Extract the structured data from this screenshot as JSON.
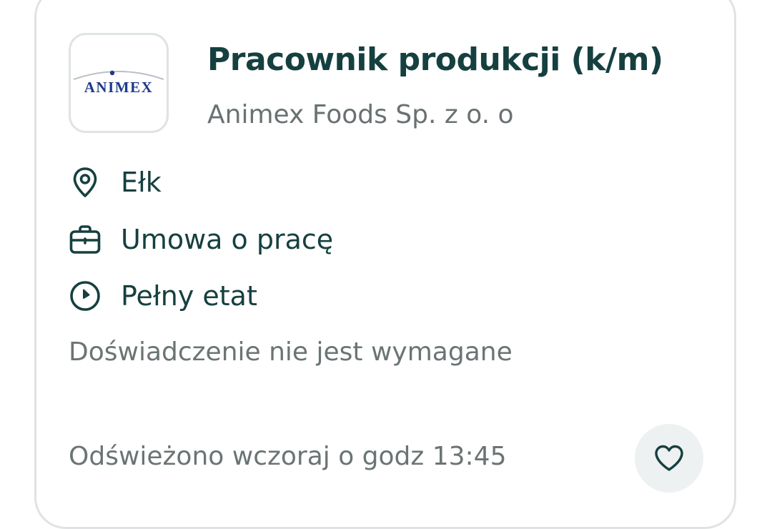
{
  "job": {
    "title": "Pracownik produkcji (k/m)",
    "company": "Animex Foods Sp. z o. o",
    "logo_text": "ANIMEX",
    "location": "Ełk",
    "contract": "Umowa o pracę",
    "time": "Pełny etat",
    "experience": "Doświadczenie nie jest wymagane",
    "refreshed": "Odświeżono wczoraj o godz 13:45"
  },
  "icons": {
    "location": "location-pin-icon",
    "contract": "briefcase-icon",
    "time": "clock-icon",
    "favorite": "heart-outline-icon"
  },
  "colors": {
    "primary_text": "#16403f",
    "secondary_text": "#6b7474",
    "border": "#dfe3e3",
    "favorite_bg": "#eef1f1",
    "logo_blue": "#1e3a8a"
  }
}
